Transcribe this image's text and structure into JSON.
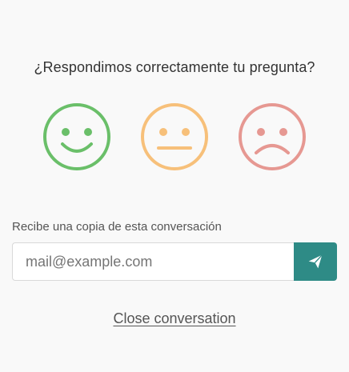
{
  "feedback": {
    "question": "¿Respondimos correctamente tu pregunta?",
    "faces": [
      {
        "icon": "happy-face-icon",
        "color": "#6abf69"
      },
      {
        "icon": "neutral-face-icon",
        "color": "#f7c07a"
      },
      {
        "icon": "sad-face-icon",
        "color": "#e69892"
      }
    ]
  },
  "transcript": {
    "label": "Recibe una copia de esta conversación",
    "email_placeholder": "mail@example.com",
    "email_value": "",
    "send_icon": "paper-plane-icon",
    "send_color": "#2e8b86"
  },
  "footer": {
    "close_label": "Close conversation"
  }
}
